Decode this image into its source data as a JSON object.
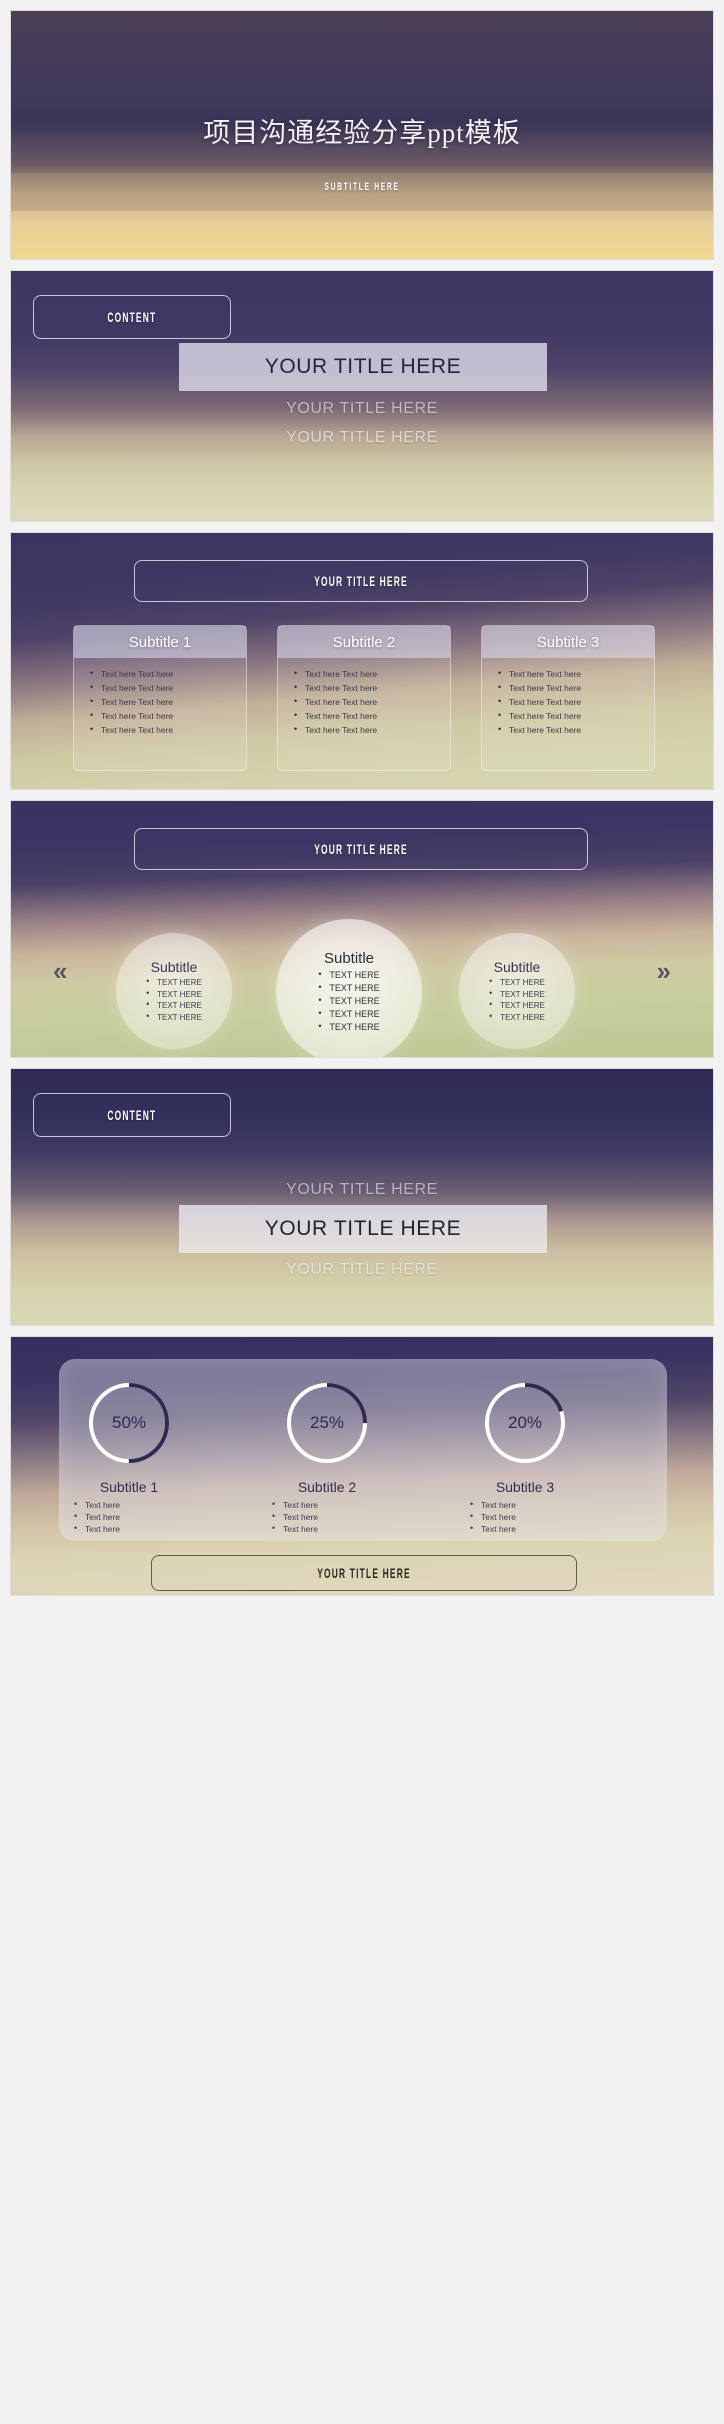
{
  "deck": {
    "accent_dark": "#2e2a50",
    "accent_light": "#ffffff"
  },
  "slide1": {
    "title": "项目沟通经验分享ppt模板",
    "subtitle": "SUBTITLE HERE"
  },
  "slide2": {
    "content_button": "CONTENT",
    "title_bar": "YOUR TITLE HERE",
    "ghost_1": "YOUR TITLE HERE",
    "ghost_2": "YOUR TITLE HERE"
  },
  "slide3": {
    "title_button": "YOUR TITLE HERE",
    "columns": [
      {
        "heading": "Subtitle 1",
        "bullets": [
          "Text here Text here",
          "Text here Text here",
          "Text here Text here",
          "Text here Text here",
          "Text here Text here"
        ]
      },
      {
        "heading": "Subtitle 2",
        "bullets": [
          "Text here Text here",
          "Text here Text here",
          "Text here Text here",
          "Text here Text here",
          "Text here Text here"
        ]
      },
      {
        "heading": "Subtitle 3",
        "bullets": [
          "Text here Text here",
          "Text here Text here",
          "Text here Text here",
          "Text here Text here",
          "Text here Text here"
        ]
      }
    ]
  },
  "slide4": {
    "title_button": "YOUR TITLE HERE",
    "prev_arrow": "«",
    "next_arrow": "»",
    "circles": [
      {
        "heading": "Subtitle",
        "bullets": [
          "TEXT HERE",
          "TEXT HERE",
          "TEXT HERE",
          "TEXT HERE"
        ]
      },
      {
        "heading": "Subtitle",
        "bullets": [
          "TEXT HERE",
          "TEXT HERE",
          "TEXT HERE",
          "TEXT HERE",
          "TEXT HERE"
        ]
      },
      {
        "heading": "Subtitle",
        "bullets": [
          "TEXT HERE",
          "TEXT HERE",
          "TEXT HERE",
          "TEXT HERE"
        ]
      }
    ]
  },
  "slide5": {
    "content_button": "CONTENT",
    "ghost_1": "YOUR TITLE HERE",
    "title_bar": "YOUR TITLE HERE",
    "ghost_2": "YOUR TITLE HERE"
  },
  "slide6": {
    "bottom_button": "YOUR TITLE HERE",
    "items": [
      {
        "percent": "50%",
        "value": 50,
        "label": "Subtitle 1",
        "bullets": [
          "Text here",
          "Text here",
          "Text here"
        ]
      },
      {
        "percent": "25%",
        "value": 25,
        "label": "Subtitle 2",
        "bullets": [
          "Text here",
          "Text here",
          "Text here"
        ]
      },
      {
        "percent": "20%",
        "value": 20,
        "label": "Subtitle 3",
        "bullets": [
          "Text here",
          "Text here",
          "Text here"
        ]
      }
    ]
  },
  "chart_data": {
    "type": "pie",
    "title": "",
    "charts": [
      {
        "label": "Subtitle 1",
        "value": 50,
        "display": "50%",
        "remainder": 50
      },
      {
        "label": "Subtitle 2",
        "value": 25,
        "display": "25%",
        "remainder": 75
      },
      {
        "label": "Subtitle 3",
        "value": 20,
        "display": "20%",
        "remainder": 80
      }
    ],
    "ylim": [
      0,
      100
    ],
    "series": [
      {
        "name": "percent",
        "values": [
          50,
          25,
          20
        ]
      }
    ],
    "categories": [
      "Subtitle 1",
      "Subtitle 2",
      "Subtitle 3"
    ],
    "legend": "none",
    "grid": false
  }
}
